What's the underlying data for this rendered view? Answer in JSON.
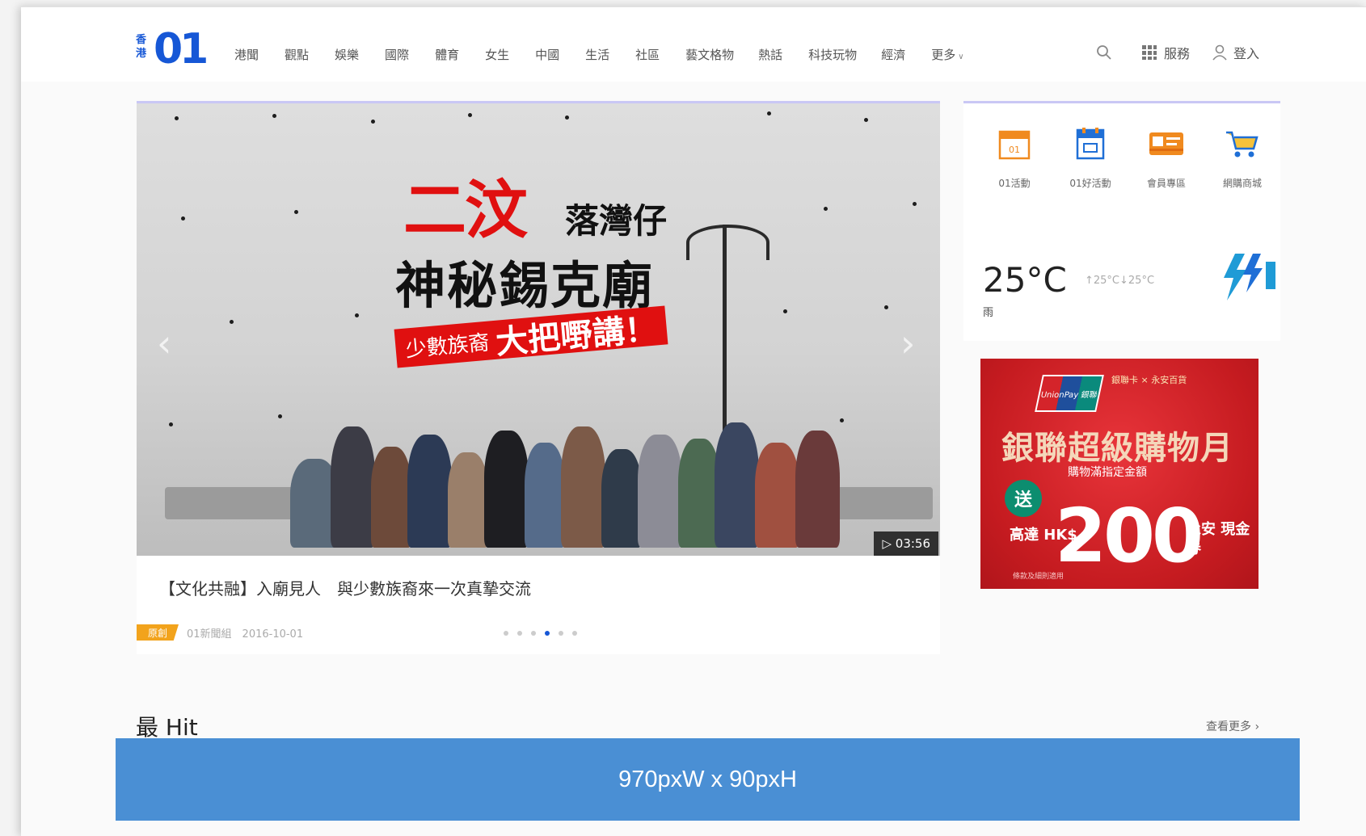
{
  "header": {
    "logo_small": "香港",
    "logo_big": "01",
    "nav": [
      "港聞",
      "觀點",
      "娛樂",
      "國際",
      "體育",
      "女生",
      "中國",
      "生活",
      "社區",
      "藝文格物",
      "熱話",
      "科技玩物",
      "經濟",
      "更多"
    ],
    "tools": {
      "services": "服務",
      "login": "登入"
    }
  },
  "hero": {
    "headline_red": "二汶",
    "headline_small": "落灣仔",
    "headline_main": "神秘錫克廟",
    "band_small": "少數族裔",
    "band_big": "大把嘢講！",
    "duration": "▷ 03:56",
    "title": "【文化共融】入廟見人　與少數族裔來一次真摯交流",
    "badge": "原創",
    "meta": "01新聞組　2016-10-01",
    "slide_count": 6,
    "active_slide": 4
  },
  "widget": {
    "shortcuts": [
      {
        "label": "01活動",
        "icon": "calendar-icon",
        "color": "#f08a1f"
      },
      {
        "label": "01好活動",
        "icon": "event-calendar-icon",
        "color": "#1f6fd6"
      },
      {
        "label": "會員專區",
        "icon": "member-card-icon",
        "color": "#f08a1f"
      },
      {
        "label": "網購商城",
        "icon": "shopping-cart-icon",
        "color": "#1f6fd6"
      }
    ],
    "temperature": "25°C",
    "temp_range": "↑25°C↓25°C",
    "weather_note": "雨",
    "weather_icon": "thunderstorm-icon"
  },
  "ad": {
    "logo_text": "UnionPay 銀聯",
    "header": "銀聯卡 × 永安百貨",
    "title": "銀聯超級購物月",
    "subtitle": "購物滿指定金額",
    "gift": "送",
    "currency": "高達 HK$",
    "amount": "200",
    "voucher": "永安 現金券",
    "fine_print": "條款及細則適用"
  },
  "section": {
    "title": "最 Hit",
    "more": "查看更多 ›"
  },
  "banner": {
    "text": "970pxW x 90pxH"
  }
}
